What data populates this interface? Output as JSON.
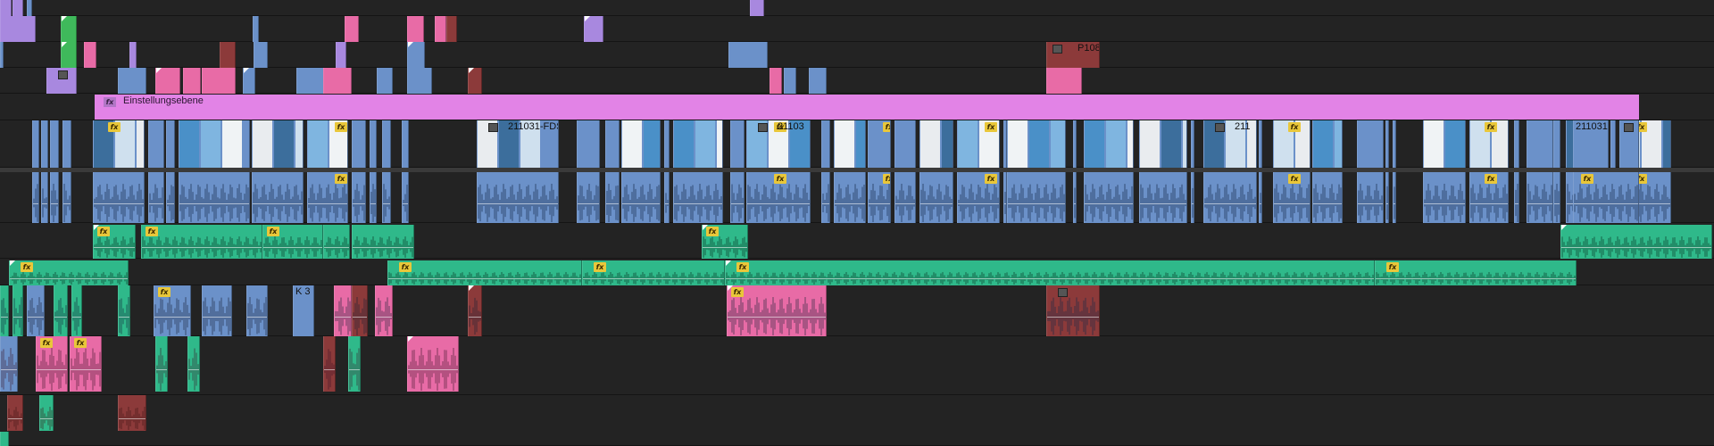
{
  "app": "Timeline",
  "colors": {
    "video": "#6b91c9",
    "video_dark": "#5577ad",
    "audio": "#6b91c9",
    "music": "#2fb98a",
    "music_dark": "#1e8a63",
    "sfx": "#e86ba6",
    "red": "#8c3a3a",
    "purple": "#a888df",
    "adjustment": "#e283e6",
    "green": "#3fb95b",
    "fx_badge": "#e9c73a",
    "track_bg": "#232323",
    "divider": "#3a3a3a"
  },
  "icons": {
    "fx": "fx-badge-icon",
    "still": "still-frame-icon"
  },
  "badge_fx": "fx",
  "labels": {
    "adjustment_layer": "Einstellungsebene",
    "p108": "P108",
    "c211031_fds": "211031-FDS-",
    "c21103": "21103",
    "c211": "211",
    "c211031": "211031",
    "k3": "K 3"
  }
}
